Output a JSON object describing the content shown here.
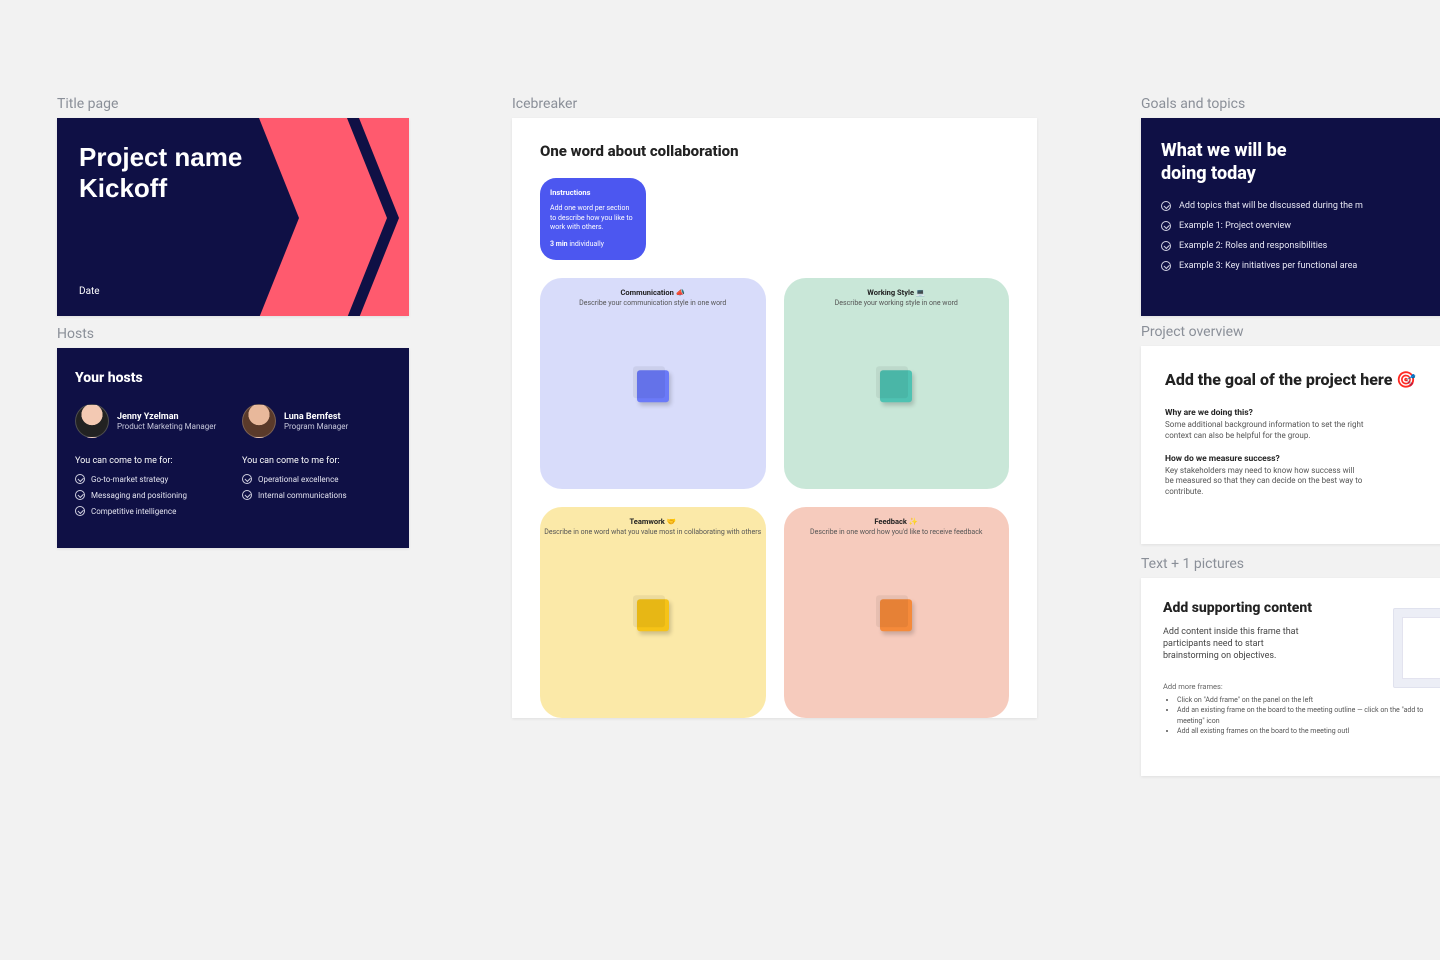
{
  "frames": {
    "title_page": {
      "label": "Title page",
      "heading_l1": "Project name",
      "heading_l2": "Kickoff",
      "date": "Date"
    },
    "hosts": {
      "label": "Hosts",
      "heading": "Your hosts",
      "come_label": "You can come to me for:",
      "people": [
        {
          "name": "Jenny Yzelman",
          "role": "Product Marketing Manager",
          "bullets": [
            "Go-to-market strategy",
            "Messaging and positioning",
            "Competitive intelligence"
          ]
        },
        {
          "name": "Luna Bernfest",
          "role": "Program Manager",
          "bullets": [
            "Operational excellence",
            "Internal communications"
          ]
        }
      ]
    },
    "icebreaker": {
      "label": "Icebreaker",
      "heading": "One word about collaboration",
      "instructions": {
        "title": "Instructions",
        "body": "Add one word per section to describe how you like to work with others.",
        "time_bold": "3 min",
        "time_rest": " individually"
      },
      "zones": [
        {
          "title": "Communication 📣",
          "sub": "Describe your communication style in one word"
        },
        {
          "title": "Working Style 💻",
          "sub": "Describe your working style in one word"
        },
        {
          "title": "Teamwork 🤝",
          "sub": "Describe in one word what you value most in collaborating with others"
        },
        {
          "title": "Feedback ✨",
          "sub": "Describe in one word how you'd like to receive feedback"
        }
      ]
    },
    "goals": {
      "label": "Goals and topics",
      "heading_l1": "What we will be",
      "heading_l2": "doing today",
      "items": [
        "Add topics that will be discussed during the m",
        "Example 1: Project overview",
        "Example 2: Roles and responsibilities",
        "Example 3: Key initiatives per functional area"
      ]
    },
    "project": {
      "label": "Project overview",
      "heading": "Add the goal of the project here 🎯",
      "q1": "Why are we doing this?",
      "a1": "Some additional background information to set the right context can also be helpful for the group.",
      "q2": "How do we measure success?",
      "a2": "Key stakeholders may need to know how success will be measured so that they can decide on the best way to contribute."
    },
    "textpic": {
      "label": "Text + 1 pictures",
      "heading": "Add supporting content",
      "body": "Add content inside this frame that participants need to start brainstorming on objectives.",
      "more": "Add more frames:",
      "bullets": [
        "Click on \"Add frame\" on the panel on the left",
        "Add an existing frame on the board to the meeting outline — click on the \"add to meeting\" icon",
        "Add all existing frames on the board to the meeting outl"
      ]
    }
  }
}
